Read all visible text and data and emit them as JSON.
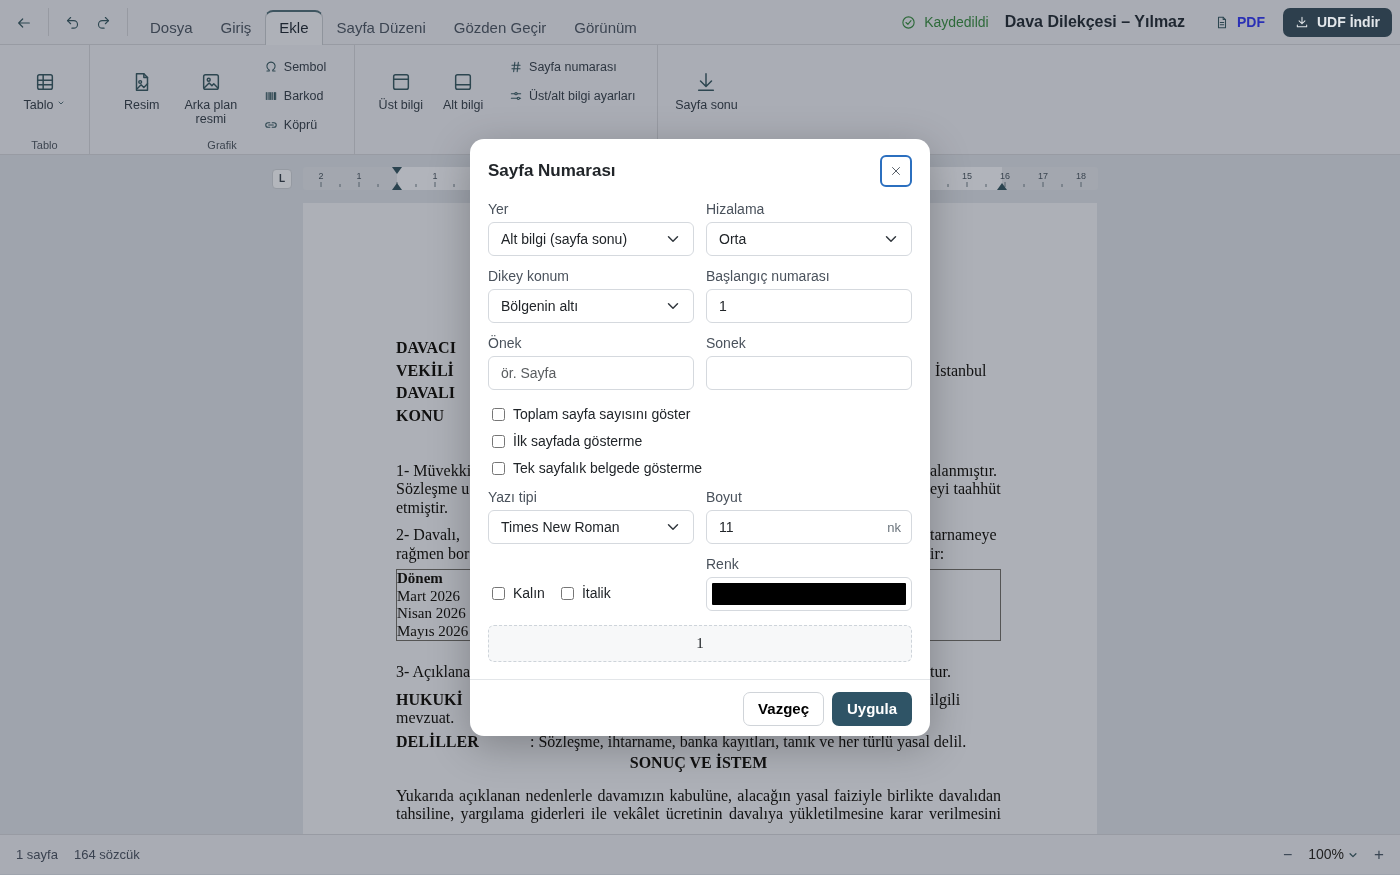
{
  "topbar": {
    "save_status": "Kaydedildi",
    "document_title": "Dava Dilekçesi – Yılmaz",
    "pdf_label": "PDF",
    "download_label": "UDF İndir"
  },
  "tabs": [
    {
      "label": "Dosya",
      "selected": false
    },
    {
      "label": "Giriş",
      "selected": false
    },
    {
      "label": "Ekle",
      "selected": true
    },
    {
      "label": "Sayfa Düzeni",
      "selected": false
    },
    {
      "label": "Gözden Geçir",
      "selected": false
    },
    {
      "label": "Görünüm",
      "selected": false
    }
  ],
  "ribbon": {
    "groups": [
      {
        "label": "Tablo",
        "items": [
          {
            "kind": "large",
            "label": "Tablo",
            "caret": true
          }
        ]
      },
      {
        "label": "Grafik",
        "items": [
          {
            "kind": "large",
            "label": "Resim",
            "caret": false
          },
          {
            "kind": "large",
            "label": "Arka plan resmi",
            "caret": false
          },
          {
            "kind": "small",
            "label": "Sembol"
          },
          {
            "kind": "small",
            "label": "Barkod"
          },
          {
            "kind": "small",
            "label": "Köprü"
          }
        ]
      },
      {
        "items": [
          {
            "kind": "large",
            "label": "Üst bilgi",
            "caret": false
          },
          {
            "kind": "large",
            "label": "Alt bilgi",
            "caret": false
          },
          {
            "kind": "small",
            "label": "Sayfa numarası"
          },
          {
            "kind": "small",
            "label": "Üst/alt bilgi ayarları"
          }
        ]
      },
      {
        "items": [
          {
            "kind": "large",
            "label": "Sayfa sonu",
            "caret": false
          }
        ]
      }
    ]
  },
  "ruler": {
    "tab_stop_label": "L",
    "labels": [
      "2",
      "1",
      "1",
      "15",
      "16",
      "17",
      "18"
    ]
  },
  "document": {
    "blocks": [
      {
        "kind": "fields",
        "rows": [
          {
            "left": "DAVACI"
          },
          {
            "left": "VEKİLİ",
            "right": "İstanbul"
          },
          {
            "left": "DAVALI"
          },
          {
            "left": "KONU"
          }
        ]
      },
      {
        "kind": "paragraph",
        "lines": [
          {
            "left": "1- Müvekki",
            "right": "alanmıştır.",
            "bold": false
          },
          {
            "left": "Sözleşme u",
            "right": "eyi taahhüt",
            "bold": false
          },
          {
            "left": "etmiştir.",
            "bold": false
          }
        ]
      },
      {
        "kind": "paragraph",
        "lines": [
          {
            "left": "2- Davalı,",
            "right": "tarnameye",
            "bold": false
          },
          {
            "left": "rağmen bor",
            "right": "ir:",
            "bold": false
          }
        ]
      },
      {
        "kind": "table",
        "cells": [
          "Dönem",
          "Mart 2026",
          "Nisan 2026",
          "Mayıs 2026"
        ]
      },
      {
        "kind": "paragraph",
        "lines": [
          {
            "left": "3- Açıklana",
            "right": "tur.",
            "bold": false
          }
        ]
      },
      {
        "kind": "paragraph",
        "lines": [
          {
            "left": "HUKUKİ",
            "right": "ilgili",
            "bold": true
          },
          {
            "left": "mevzuat.",
            "bold": false
          }
        ]
      },
      {
        "kind": "labeled",
        "label": "DELİLLER",
        "value": ": Sözleşme, ihtarname, banka kayıtları, tanık ve her türlü yasal delil."
      },
      {
        "kind": "heading",
        "text": "SONUÇ VE İSTEM"
      },
      {
        "kind": "justified",
        "lines": [
          "Yukarıda açıklanan nedenlerle davamızın kabulüne, alacağın yasal faiziyle birlikte davalıdan",
          "tahsiline, yargılama giderleri ile vekâlet ücretinin davalıya yükletilmesine karar verilmesini"
        ]
      }
    ]
  },
  "dialog": {
    "title": "Sayfa Numarası",
    "position": {
      "label": "Yer",
      "value": "Alt bilgi (sayfa sonu)"
    },
    "alignment": {
      "label": "Hizalama",
      "value": "Orta"
    },
    "vertical": {
      "label": "Dikey konum",
      "value": "Bölgenin altı"
    },
    "start_number": {
      "label": "Başlangıç numarası",
      "value": "1"
    },
    "prefix": {
      "label": "Önek",
      "placeholder": "ör. Sayfa"
    },
    "suffix": {
      "label": "Sonek"
    },
    "options": [
      {
        "label": "Toplam sayfa sayısını göster",
        "checked": false
      },
      {
        "label": "İlk sayfada gösterme",
        "checked": false
      },
      {
        "label": "Tek sayfalık belgede gösterme",
        "checked": false
      }
    ],
    "font": {
      "label": "Yazı tipi",
      "value": "Times New Roman"
    },
    "size": {
      "label": "Boyut",
      "value": "11",
      "unit": "nk"
    },
    "color": {
      "label": "Renk",
      "color": "#000000"
    },
    "styles": [
      {
        "label": "Kalın",
        "checked": false
      },
      {
        "label": "İtalik",
        "checked": false
      }
    ],
    "preview": "1",
    "buttons": {
      "cancel": "Vazgeç",
      "apply": "Uygula"
    }
  },
  "status_bar": {
    "pages": "1 sayfa",
    "words": "164 sözcük",
    "zoom": "100%",
    "zoom_out": "−",
    "zoom_in": "+"
  }
}
